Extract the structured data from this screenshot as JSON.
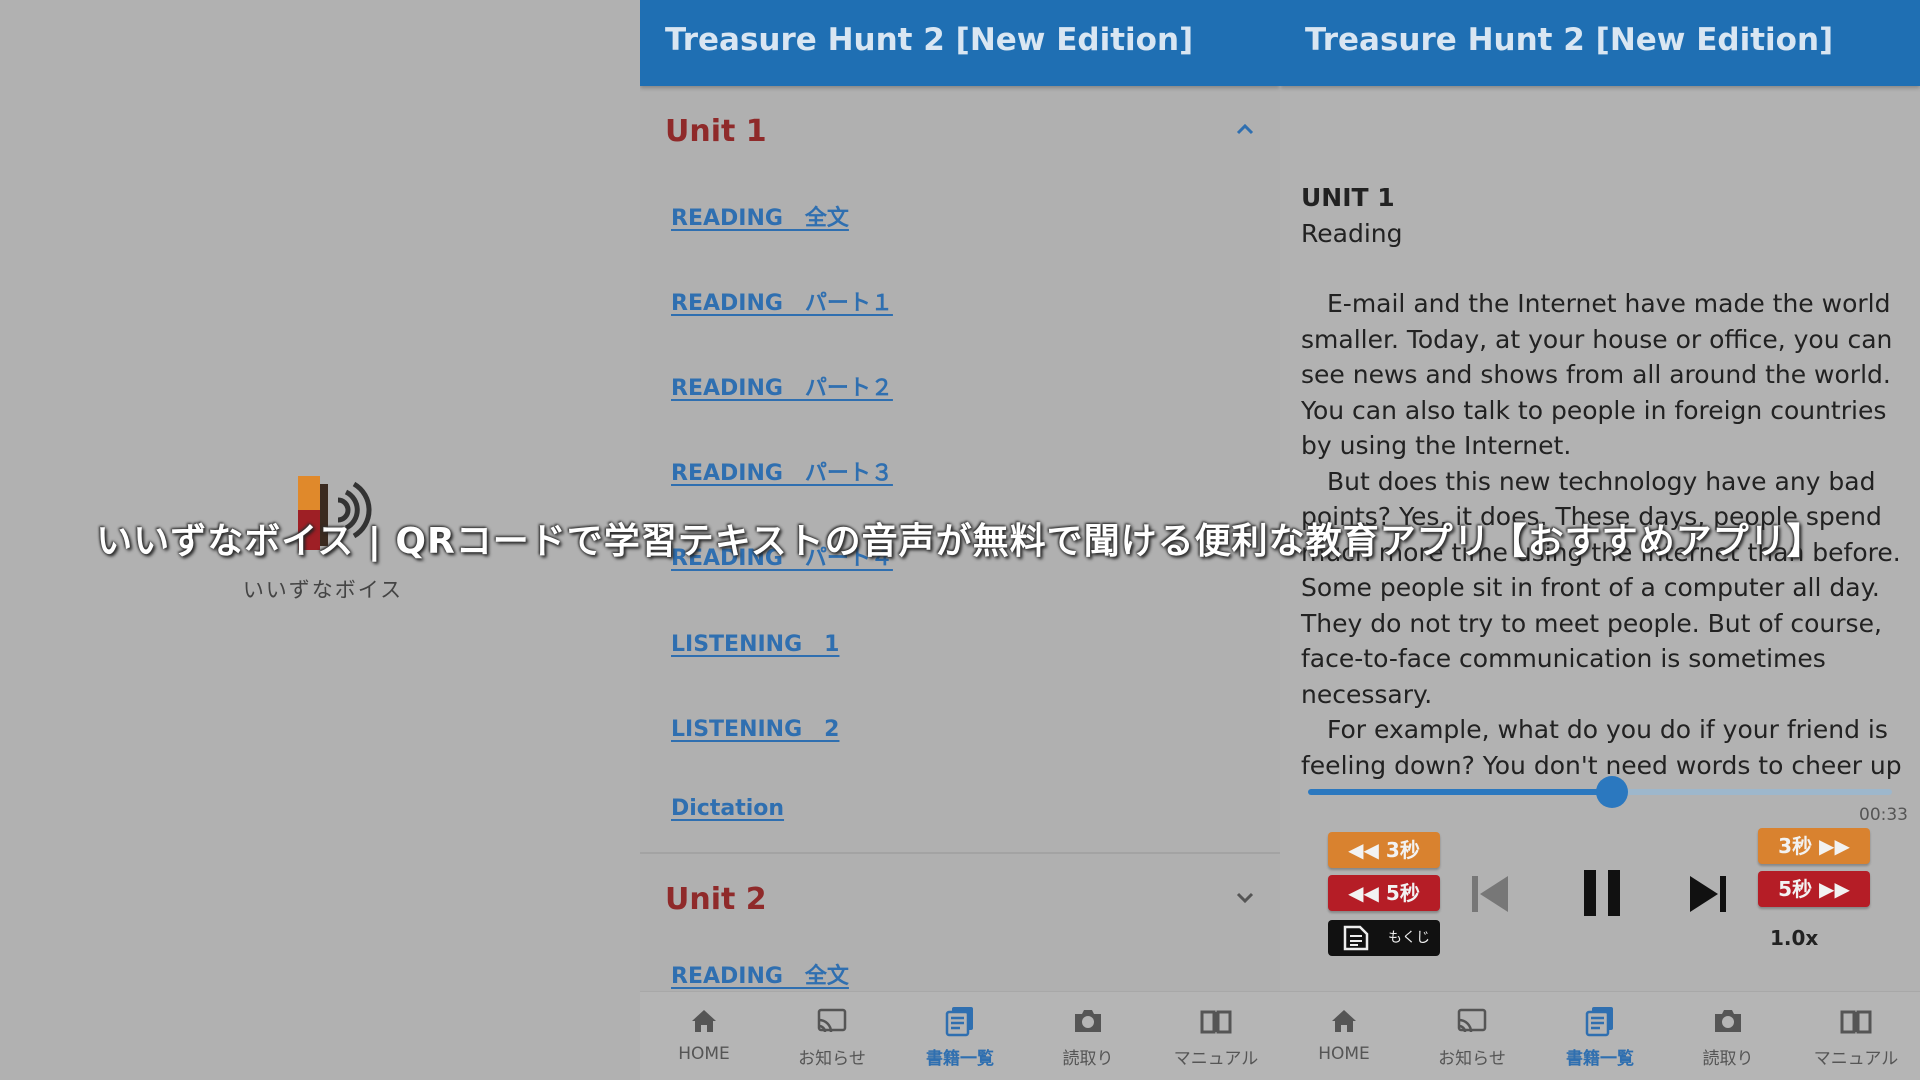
{
  "logo": {
    "text": "いいずなボイス"
  },
  "caption": "いいずなボイス | QRコードで学習テキストの音声が無料で聞ける便利な教育アプリ【おすすめアプリ】",
  "list_panel": {
    "title": "Treasure Hunt 2 [New Edition]",
    "unit1": {
      "title": "Unit 1",
      "items": [
        "READING　全文",
        "READING　パート１",
        "READING　パート２",
        "READING　パート３",
        "READING　パート４",
        "LISTENING　1",
        "LISTENING　2",
        "Dictation"
      ]
    },
    "unit2": {
      "title": "Unit 2",
      "items": [
        "READING　全文"
      ]
    }
  },
  "player_panel": {
    "title": "Treasure Hunt 2 [New Edition]",
    "unit_heading": "UNIT 1",
    "section": "Reading",
    "paragraphs": [
      "E-mail and the Internet have made the world smaller. Today, at your house or office, you can see news and shows from all around the world. You can also talk to people in foreign countries by using the Internet.",
      "But does this new technology have any bad points? Yes, it does. These days, people spend much more time using the Internet than before. Some people sit in front of a computer all day. They do not try to meet people. But of course, face-to-face communication is sometimes necessary.",
      "For example, what do you do if your friend is feeling down? You don't need words to cheer up"
    ],
    "progress_fraction": 0.52,
    "time": "00:33",
    "buttons": {
      "back3": "3秒",
      "back5": "5秒",
      "fwd3": "3秒",
      "fwd5": "5秒",
      "toc": "もくじ"
    },
    "speed": "1.0x",
    "colors": {
      "orange": "#d9822f",
      "red": "#b51d26",
      "accent": "#2b78bf"
    }
  },
  "nav": [
    "HOME",
    "お知らせ",
    "書籍一覧",
    "読取り",
    "マニュアル"
  ],
  "nav_active_index": 2
}
